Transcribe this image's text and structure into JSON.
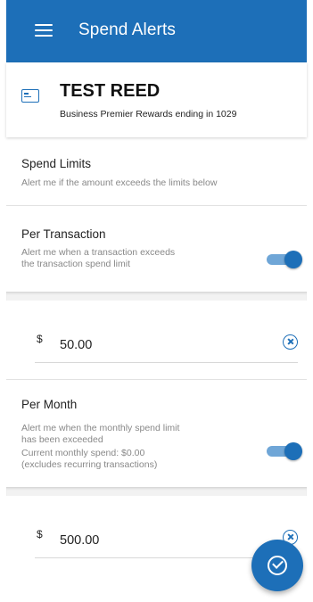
{
  "app_bar": {
    "title": "Spend Alerts",
    "menu_icon": "hamburger-menu-icon",
    "color": "#1d6fb8"
  },
  "card": {
    "icon": "credit-card-icon",
    "name": "TEST REED",
    "subtitle": "Business Premier Rewards ending in 1029"
  },
  "spend_limits": {
    "title": "Spend Limits",
    "description": "Alert me if the amount exceeds the limits below"
  },
  "per_transaction": {
    "title": "Per Transaction",
    "description_line1": "Alert me when a transaction exceeds",
    "description_line2": "the transaction spend limit",
    "enabled": true,
    "currency": "$",
    "amount": "50.00"
  },
  "per_month": {
    "title": "Per Month",
    "description_line1": "Alert me when the monthly spend limit",
    "description_line2": "has been exceeded",
    "current_line1": "Current monthly spend: $0.00",
    "current_line2": "(excludes recurring transactions)",
    "enabled": true,
    "currency": "$",
    "amount": "500.00"
  },
  "fab": {
    "icon": "check-circle-icon"
  }
}
